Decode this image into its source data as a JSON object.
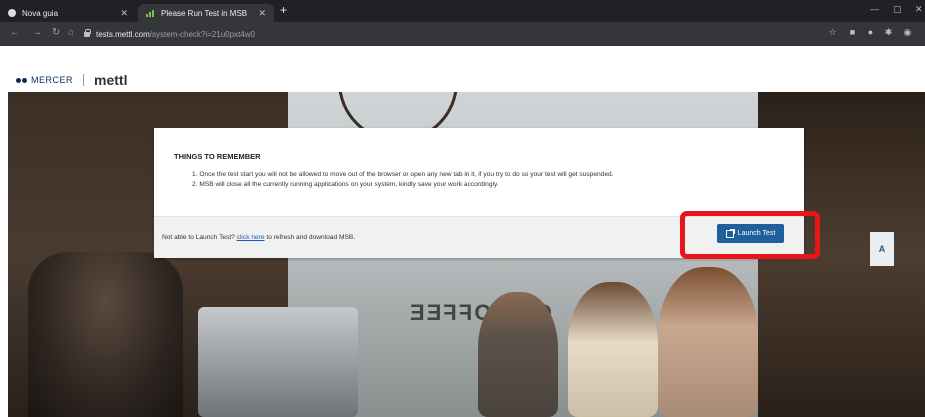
{
  "browser": {
    "tabs": [
      {
        "title": "Nova guia",
        "active": false
      },
      {
        "title": "Please Run Test in MSB",
        "active": true
      }
    ],
    "new_tab": "+",
    "url_host": "tests.mettl.com",
    "url_path": "/system-check?i=21u0pxt4w0"
  },
  "header": {
    "mercer_label": "MERCER",
    "mettl_label": "mettl"
  },
  "hero": {
    "sign_text": "OF COFFEE",
    "a_sign": "A"
  },
  "dialog": {
    "title": "THINGS TO REMEMBER",
    "rules": [
      "1. Once the test start you will not be allowed to move out of the browser or open any new tab in it, if you try to do so your test will get suspended.",
      "2. MSB will close all the currently running applications on your system, kindly save your work accordingly."
    ],
    "footer_prefix": "Not able to Launch Test?",
    "footer_link": "click here",
    "footer_suffix": "to refresh and download MSB.",
    "launch_label": "Launch Test"
  },
  "colors": {
    "primary_button": "#1f5f9a",
    "highlight": "#e8151b",
    "link": "#1a5fb4"
  }
}
